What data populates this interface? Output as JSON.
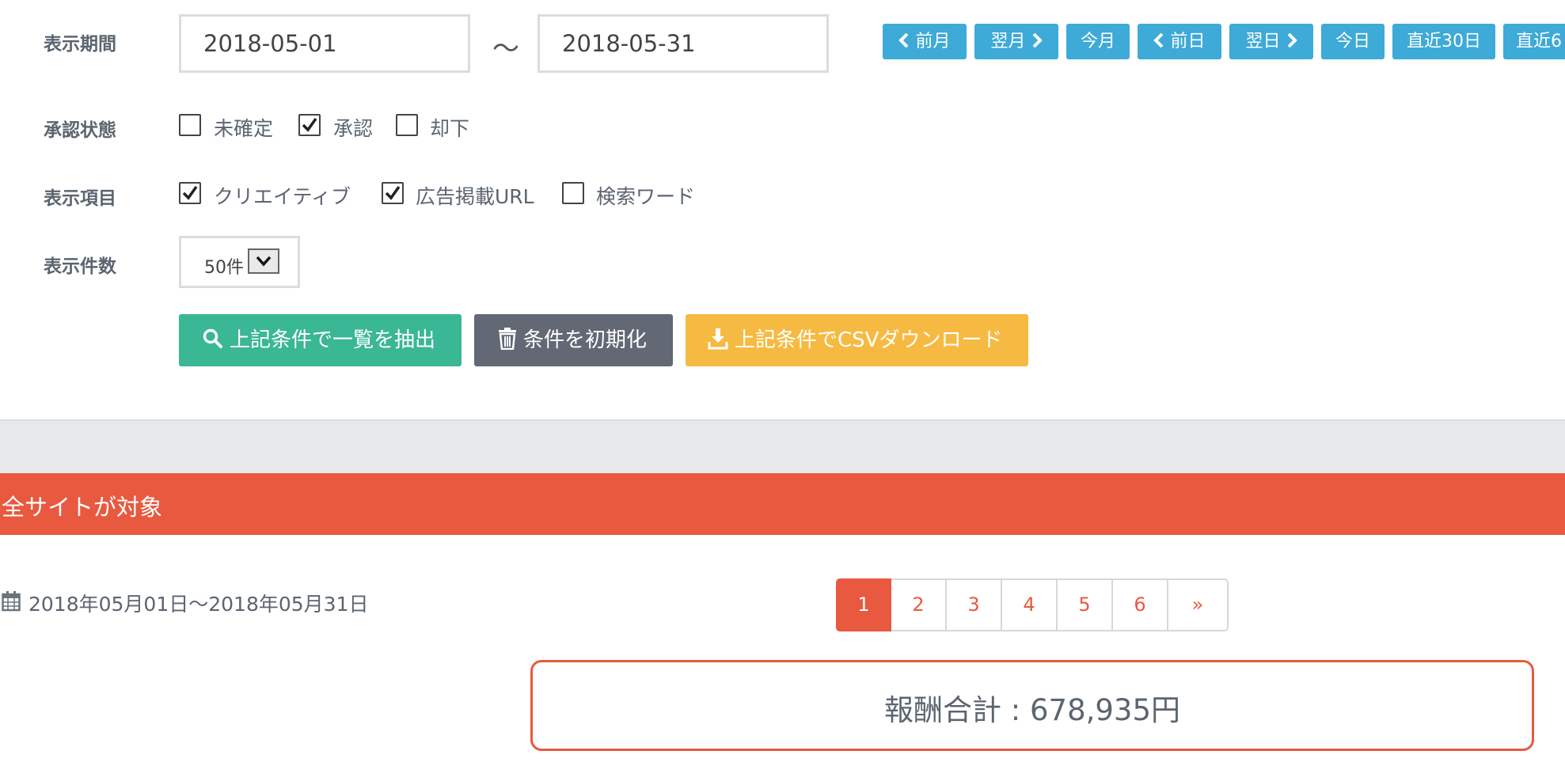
{
  "filters": {
    "period_label": "表示期間",
    "date_from": "2018-05-01",
    "date_separator": "〜",
    "date_to": "2018-05-31",
    "approval_label": "承認状態",
    "display_items_label": "表示項目",
    "count_label": "表示件数",
    "count_value": "50件"
  },
  "quick_buttons": {
    "prev_month": "前月",
    "next_month": "翌月",
    "this_month": "今月",
    "prev_day": "前日",
    "next_day": "翌日",
    "today": "今日",
    "last30": "直近30日",
    "last_partial": "直近6"
  },
  "approval_options": [
    {
      "label": "未確定",
      "checked": false
    },
    {
      "label": "承認",
      "checked": true
    },
    {
      "label": "却下",
      "checked": false
    }
  ],
  "display_options": [
    {
      "label": "クリエイティブ",
      "checked": true
    },
    {
      "label": "広告掲載URL",
      "checked": true
    },
    {
      "label": "検索ワード",
      "checked": false
    }
  ],
  "actions": {
    "search": "上記条件で一覧を抽出",
    "reset": "条件を初期化",
    "csv": "上記条件でCSVダウンロード"
  },
  "banner": {
    "text": "全サイトが対象"
  },
  "result": {
    "date_range": "2018年05月01日〜2018年05月31日",
    "total": "報酬合計 : 678,935円"
  },
  "pagination": {
    "pages": [
      "1",
      "2",
      "3",
      "4",
      "5",
      "6"
    ],
    "next": "»",
    "active": "1"
  },
  "colors": {
    "quick_button": "#3eaad7",
    "search_button": "#3ab795",
    "reset_button": "#636875",
    "csv_button": "#f6ba42",
    "banner": "#e8593f",
    "separator_band": "#e8e9ed"
  },
  "icons": {
    "search": "search-icon",
    "reset": "trash-icon",
    "csv": "download-icon",
    "date": "calendar-icon"
  }
}
